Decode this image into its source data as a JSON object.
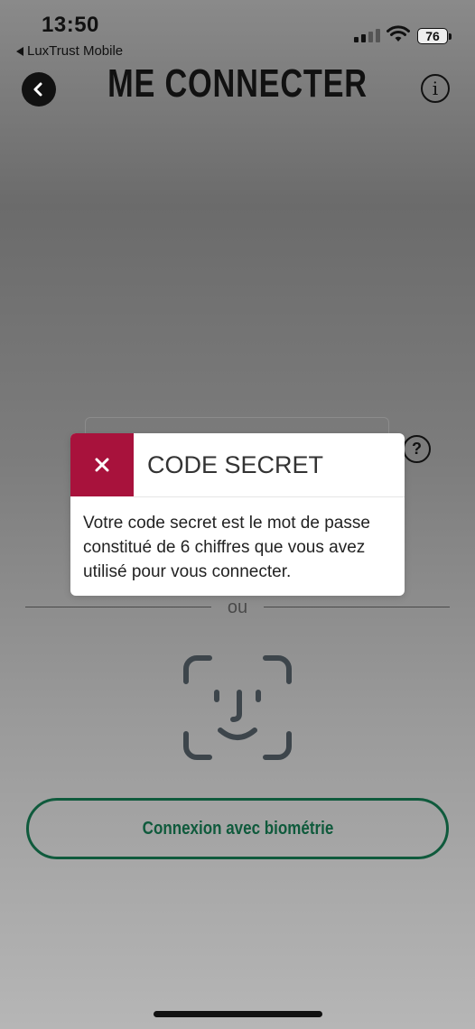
{
  "status_bar": {
    "time": "13:50",
    "back_app": "LuxTrust Mobile",
    "battery": "76"
  },
  "header": {
    "title": "ME CONNECTER"
  },
  "form": {
    "help_label": "?",
    "separator": "ou"
  },
  "biometric": {
    "button_label": "Connexion avec biométrie"
  },
  "modal": {
    "title": "CODE SECRET",
    "body": "Votre code secret est le mot de passe constitué de 6 chiffres que vous avez utilisé pour vous connecter."
  },
  "colors": {
    "accent_red": "#a8123c",
    "accent_green": "#0f5a3c"
  },
  "icons": [
    "back-icon",
    "info-icon",
    "close-icon",
    "face-id-icon",
    "wifi-icon",
    "signal-icon",
    "battery-icon"
  ]
}
